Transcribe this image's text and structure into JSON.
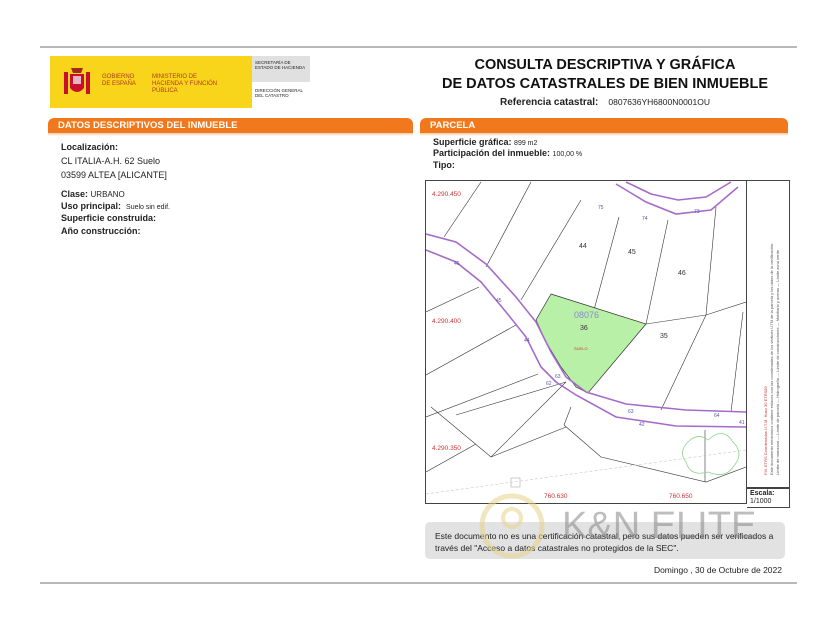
{
  "header": {
    "logo_gobierno": "GOBIERNO DE ESPAÑA",
    "logo_ministerio": "MINISTERIO DE HACIENDA Y FUNCIÓN PÚBLICA",
    "secretaria": "SECRETARÍA DE ESTADO DE HACIENDA",
    "direccion": "DIRECCIÓN GENERAL DEL CATASTRO",
    "title_line1": "CONSULTA DESCRIPTIVA Y GRÁFICA",
    "title_line2": "DE DATOS CATASTRALES DE BIEN INMUEBLE",
    "ref_label": "Referencia catastral:",
    "ref_value": "0807636YH6800N0001OU"
  },
  "inmueble": {
    "section_title": "DATOS DESCRIPTIVOS DEL INMUEBLE",
    "localizacion_label": "Localización:",
    "address_line1": "CL ITALIA-A.H. 62 Suelo",
    "address_line2": "03599 ALTEA [ALICANTE]",
    "clase_label": "Clase:",
    "clase_value": "URBANO",
    "uso_label": "Uso principal:",
    "uso_value": "Suelo sin edif.",
    "superficie_label": "Superficie construida:",
    "anio_label": "Año construcción:"
  },
  "parcela": {
    "section_title": "PARCELA",
    "superficie_label": "Superficie gráfica:",
    "superficie_value": "899 m2",
    "participacion_label": "Participación del inmueble:",
    "participacion_value": "100,00 %",
    "tipo_label": "Tipo:"
  },
  "map": {
    "coords_y": [
      "4.290.450",
      "4.290.400",
      "4.290.350"
    ],
    "coords_x": [
      "760.630",
      "760.650"
    ],
    "parcel_labels": [
      "44",
      "45",
      "46",
      "36",
      "35"
    ],
    "subject_parcel": "08076",
    "subject_use": "SUELO",
    "street_numbers": [
      "75",
      "74",
      "73",
      "46",
      "45",
      "44",
      "63",
      "62",
      "63",
      "64",
      "42",
      "41"
    ],
    "legend": "Este documento electrónico contiene enlaces con las coordenadas de los vértices UTM de la parcela y los datos de la certificación.",
    "legend_items": [
      "Límite de manzana",
      "Límite de parcela",
      "Hidrografía",
      "Límite de construcciones",
      "Mobiliario y aceras",
      "Límite zona verde"
    ],
    "utm_note": "FM. ETRS Coordenadas U.T.M. Huso 30 ETRS89",
    "scale_label": "Escala:",
    "scale_value": "1/1000",
    "parcel_color": "#b8f0a8"
  },
  "footer": {
    "notice": "Este documento no es una certificación catastral, pero sus datos pueden ser verificados a través del \"Acceso a datos catastrales no protegidos de la SEC\".",
    "date": "Domingo , 30 de Octubre de 2022",
    "watermark": "K&N ELITE AGENCY"
  },
  "colors": {
    "accent": "#f2781e",
    "logo_yellow": "#f8d41a",
    "road": "#a66bc9"
  }
}
